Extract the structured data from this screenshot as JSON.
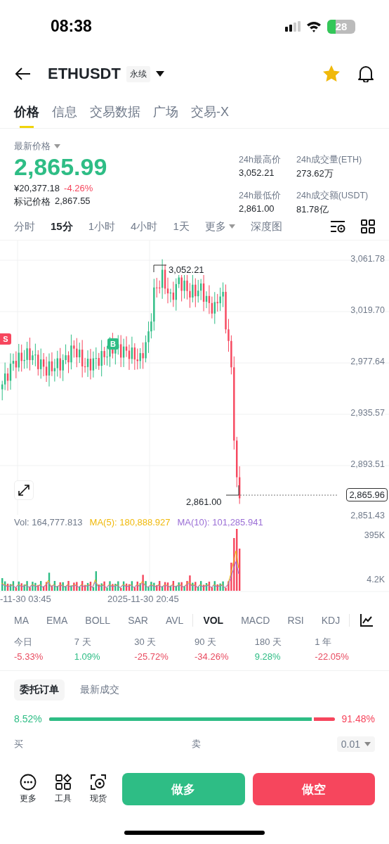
{
  "status_bar": {
    "time": "08:38",
    "battery": "28"
  },
  "header": {
    "symbol": "ETHUSDT",
    "badge": "永续",
    "favorite": true
  },
  "tabs": [
    {
      "label": "价格",
      "selected": true
    },
    {
      "label": "信息",
      "selected": false
    },
    {
      "label": "交易数据",
      "selected": false
    },
    {
      "label": "广场",
      "selected": false
    },
    {
      "label": "交易-X",
      "selected": false
    }
  ],
  "price": {
    "label": "最新价格",
    "last": "2,865.99",
    "cny": "¥20,377.18",
    "change": "-4.26%",
    "mark_label": "标记价格",
    "mark": "2,867.55"
  },
  "stats": [
    {
      "label": "24h最高价",
      "value": "3,052.21"
    },
    {
      "label": "24h成交量(ETH)",
      "value": "273.62万"
    },
    {
      "label": "24h最低价",
      "value": "2,861.00"
    },
    {
      "label": "24h成交额(USDT)",
      "value": "81.78亿"
    }
  ],
  "intervals": [
    {
      "label": "分时",
      "selected": false,
      "kind": "plain"
    },
    {
      "label": "15分",
      "selected": true,
      "kind": "plain"
    },
    {
      "label": "1小时",
      "selected": false,
      "kind": "plain"
    },
    {
      "label": "4小时",
      "selected": false,
      "kind": "plain"
    },
    {
      "label": "1天",
      "selected": false,
      "kind": "plain"
    },
    {
      "label": "更多",
      "selected": false,
      "kind": "dropdown"
    },
    {
      "label": "深度图",
      "selected": false,
      "kind": "plain"
    }
  ],
  "chart": {
    "price_axis": [
      "3,061.78",
      "3,019.70",
      "2,977.64",
      "2,935.57",
      "2,893.51",
      "2,851.43"
    ],
    "high_label": "3,052.21",
    "low_label": "2,861.00",
    "current_price": "2,865.96",
    "sell_marker": "S",
    "buy_marker": "B",
    "volume_legend": [
      {
        "text": "Vol: 164,777.813",
        "color": "#707a8a"
      },
      {
        "text": "MA(5): 180,888.927",
        "color": "#f0b90b"
      },
      {
        "text": "MA(10): 101,285.941",
        "color": "#9b6fd6"
      }
    ],
    "volume_axis": [
      "395K",
      "4.2K"
    ],
    "time_axis": [
      "-11-30 03:45",
      "2025-11-30 20:45"
    ]
  },
  "indicators": [
    {
      "label": "MA",
      "selected": false
    },
    {
      "label": "EMA",
      "selected": false
    },
    {
      "label": "BOLL",
      "selected": false
    },
    {
      "label": "SAR",
      "selected": false
    },
    {
      "label": "AVL",
      "selected": false
    },
    {
      "label": "VOL",
      "selected": true
    },
    {
      "label": "MACD",
      "selected": false
    },
    {
      "label": "RSI",
      "selected": false
    },
    {
      "label": "KDJ",
      "selected": false
    }
  ],
  "performance": [
    {
      "period": "今日",
      "value": "-5.33%",
      "color": "#e84a5f"
    },
    {
      "period": "7 天",
      "value": "1.09%",
      "color": "#2ebd85"
    },
    {
      "period": "30 天",
      "value": "-25.72%",
      "color": "#e84a5f"
    },
    {
      "period": "90 天",
      "value": "-34.26%",
      "color": "#e84a5f"
    },
    {
      "period": "180 天",
      "value": "9.28%",
      "color": "#2ebd85"
    },
    {
      "period": "1 年",
      "value": "-22.05%",
      "color": "#e84a5f"
    }
  ],
  "book_tabs": [
    {
      "label": "委托订单",
      "selected": true
    },
    {
      "label": "最新成交",
      "selected": false
    }
  ],
  "ratio": {
    "buy": "8.52%",
    "sell": "91.48%",
    "level": 0.92
  },
  "book_header": {
    "buy": "买",
    "sell": "卖",
    "precision": "0.01"
  },
  "bottom_bar": {
    "tools": [
      {
        "label": "更多",
        "kind": "more"
      },
      {
        "label": "工具",
        "kind": "tools"
      },
      {
        "label": "现货",
        "kind": "spot"
      }
    ],
    "long": "做多",
    "short": "做空"
  }
}
